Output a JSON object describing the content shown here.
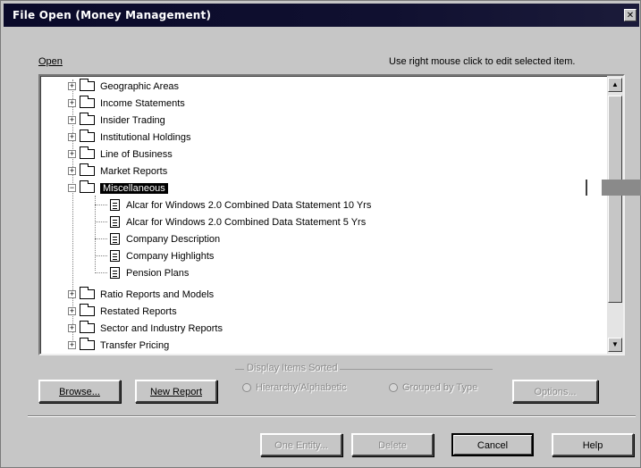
{
  "window": {
    "title": "File Open   (Money Management)"
  },
  "labels": {
    "open": "Open",
    "hint": "Use right mouse click to edit selected item."
  },
  "tree": [
    {
      "label": "Geographic Areas",
      "type": "folder",
      "expanded": false
    },
    {
      "label": "Income Statements",
      "type": "folder",
      "expanded": false
    },
    {
      "label": "Insider Trading",
      "type": "folder",
      "expanded": false
    },
    {
      "label": "Institutional Holdings",
      "type": "folder",
      "expanded": false
    },
    {
      "label": "Line of Business",
      "type": "folder",
      "expanded": false
    },
    {
      "label": "Market Reports",
      "type": "folder",
      "expanded": false
    },
    {
      "label": "Miscellaneous",
      "type": "folder",
      "expanded": true,
      "selected": true
    },
    {
      "label": "Alcar for Windows 2.0 Combined Data Statement 10 Yrs",
      "type": "document"
    },
    {
      "label": "Alcar for Windows 2.0 Combined Data Statement 5 Yrs",
      "type": "document"
    },
    {
      "label": "Company Description",
      "type": "document"
    },
    {
      "label": "Company Highlights",
      "type": "document"
    },
    {
      "label": "Pension Plans",
      "type": "document"
    },
    {
      "label": "Ratio Reports and Models",
      "type": "folder",
      "expanded": false
    },
    {
      "label": "Restated Reports",
      "type": "folder",
      "expanded": false
    },
    {
      "label": "Sector and Industry Reports",
      "type": "folder",
      "expanded": false
    },
    {
      "label": "Transfer Pricing",
      "type": "folder",
      "expanded": false
    }
  ],
  "buttons": {
    "browse": "Browse...",
    "new_report": "New Report",
    "options": "Options...",
    "one_entity": "One Entity...",
    "delete": "Delete",
    "cancel": "Cancel",
    "help": "Help"
  },
  "display_group": {
    "label": "Display Items Sorted",
    "options": [
      "Hierarchy/Alphabetic",
      "Grouped by Type"
    ]
  },
  "icons": {
    "close": "close-icon",
    "folder": "folder-icon",
    "document": "document-icon",
    "scroll_up": "scroll-up-icon",
    "scroll_down": "scroll-down-icon"
  }
}
